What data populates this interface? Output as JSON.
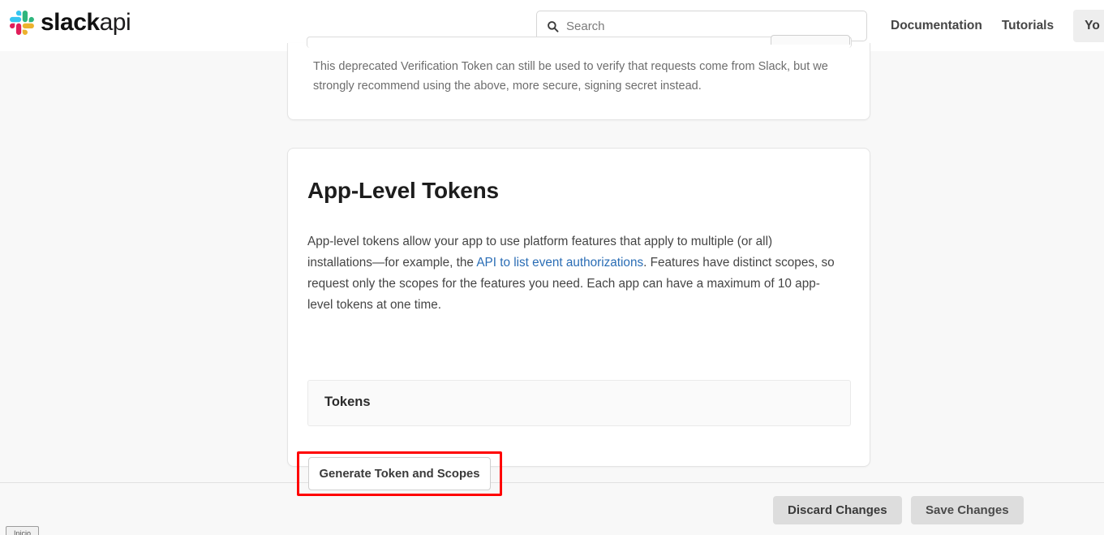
{
  "header": {
    "logo_text_bold": "slack",
    "logo_text_light": "api",
    "logo_icon": "slack-hash-icon",
    "search": {
      "icon": "search-icon",
      "placeholder": "Search",
      "value": ""
    },
    "nav_links": [
      {
        "label": "Documentation"
      },
      {
        "label": "Tutorials"
      }
    ],
    "your_apps_button": "Yo"
  },
  "cards": {
    "verification": {
      "note": "This deprecated Verification Token can still be used to verify that requests come from Slack, but we strongly recommend using the above, more secure, signing secret instead."
    },
    "app_level_tokens": {
      "title": "App-Level Tokens",
      "body_part1": "App-level tokens allow your app to use platform features that apply to multiple (or all) installations—for example, the ",
      "body_link": "API to list event authorizations",
      "body_part2": ". Features have distinct scopes, so request only the scopes for the features you need. Each app can have a maximum of 10 app-level tokens at one time.",
      "tokens_panel_title": "Tokens",
      "generate_button": "Generate Token and Scopes"
    }
  },
  "footer": {
    "discard_label": "Discard Changes",
    "save_label": "Save Changes"
  },
  "taskbar": {
    "chip_label": "Inicio"
  },
  "colors": {
    "page_background": "#f8f8f8",
    "card_background": "#ffffff",
    "link": "#2a6db5",
    "annotation_red": "#ff0000",
    "footer_button": "#dddddd",
    "slack_green": "#2eb67d",
    "slack_blue": "#36c5f0",
    "slack_yellow": "#ecb22e",
    "slack_red": "#e01e5a"
  }
}
